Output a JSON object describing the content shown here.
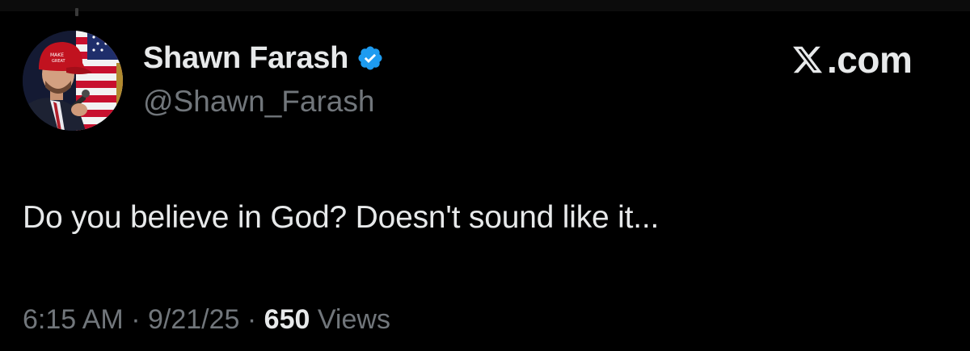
{
  "post": {
    "author": {
      "display_name": "Shawn Farash",
      "handle": "@Shawn_Farash",
      "verified": true,
      "avatar_icon": "profile-photo"
    },
    "brand": {
      "text": ".com",
      "icon": "x-logo-icon"
    },
    "text": "Do you believe in God? Doesn't sound like it...",
    "meta": {
      "time": "6:15 AM",
      "separator": "·",
      "date": "9/21/25",
      "views_count": "650",
      "views_label": "Views"
    }
  },
  "colors": {
    "background": "#000000",
    "primary_text": "#e7e9ea",
    "secondary_text": "#71767b",
    "verified_badge": "#1d9bf0"
  }
}
